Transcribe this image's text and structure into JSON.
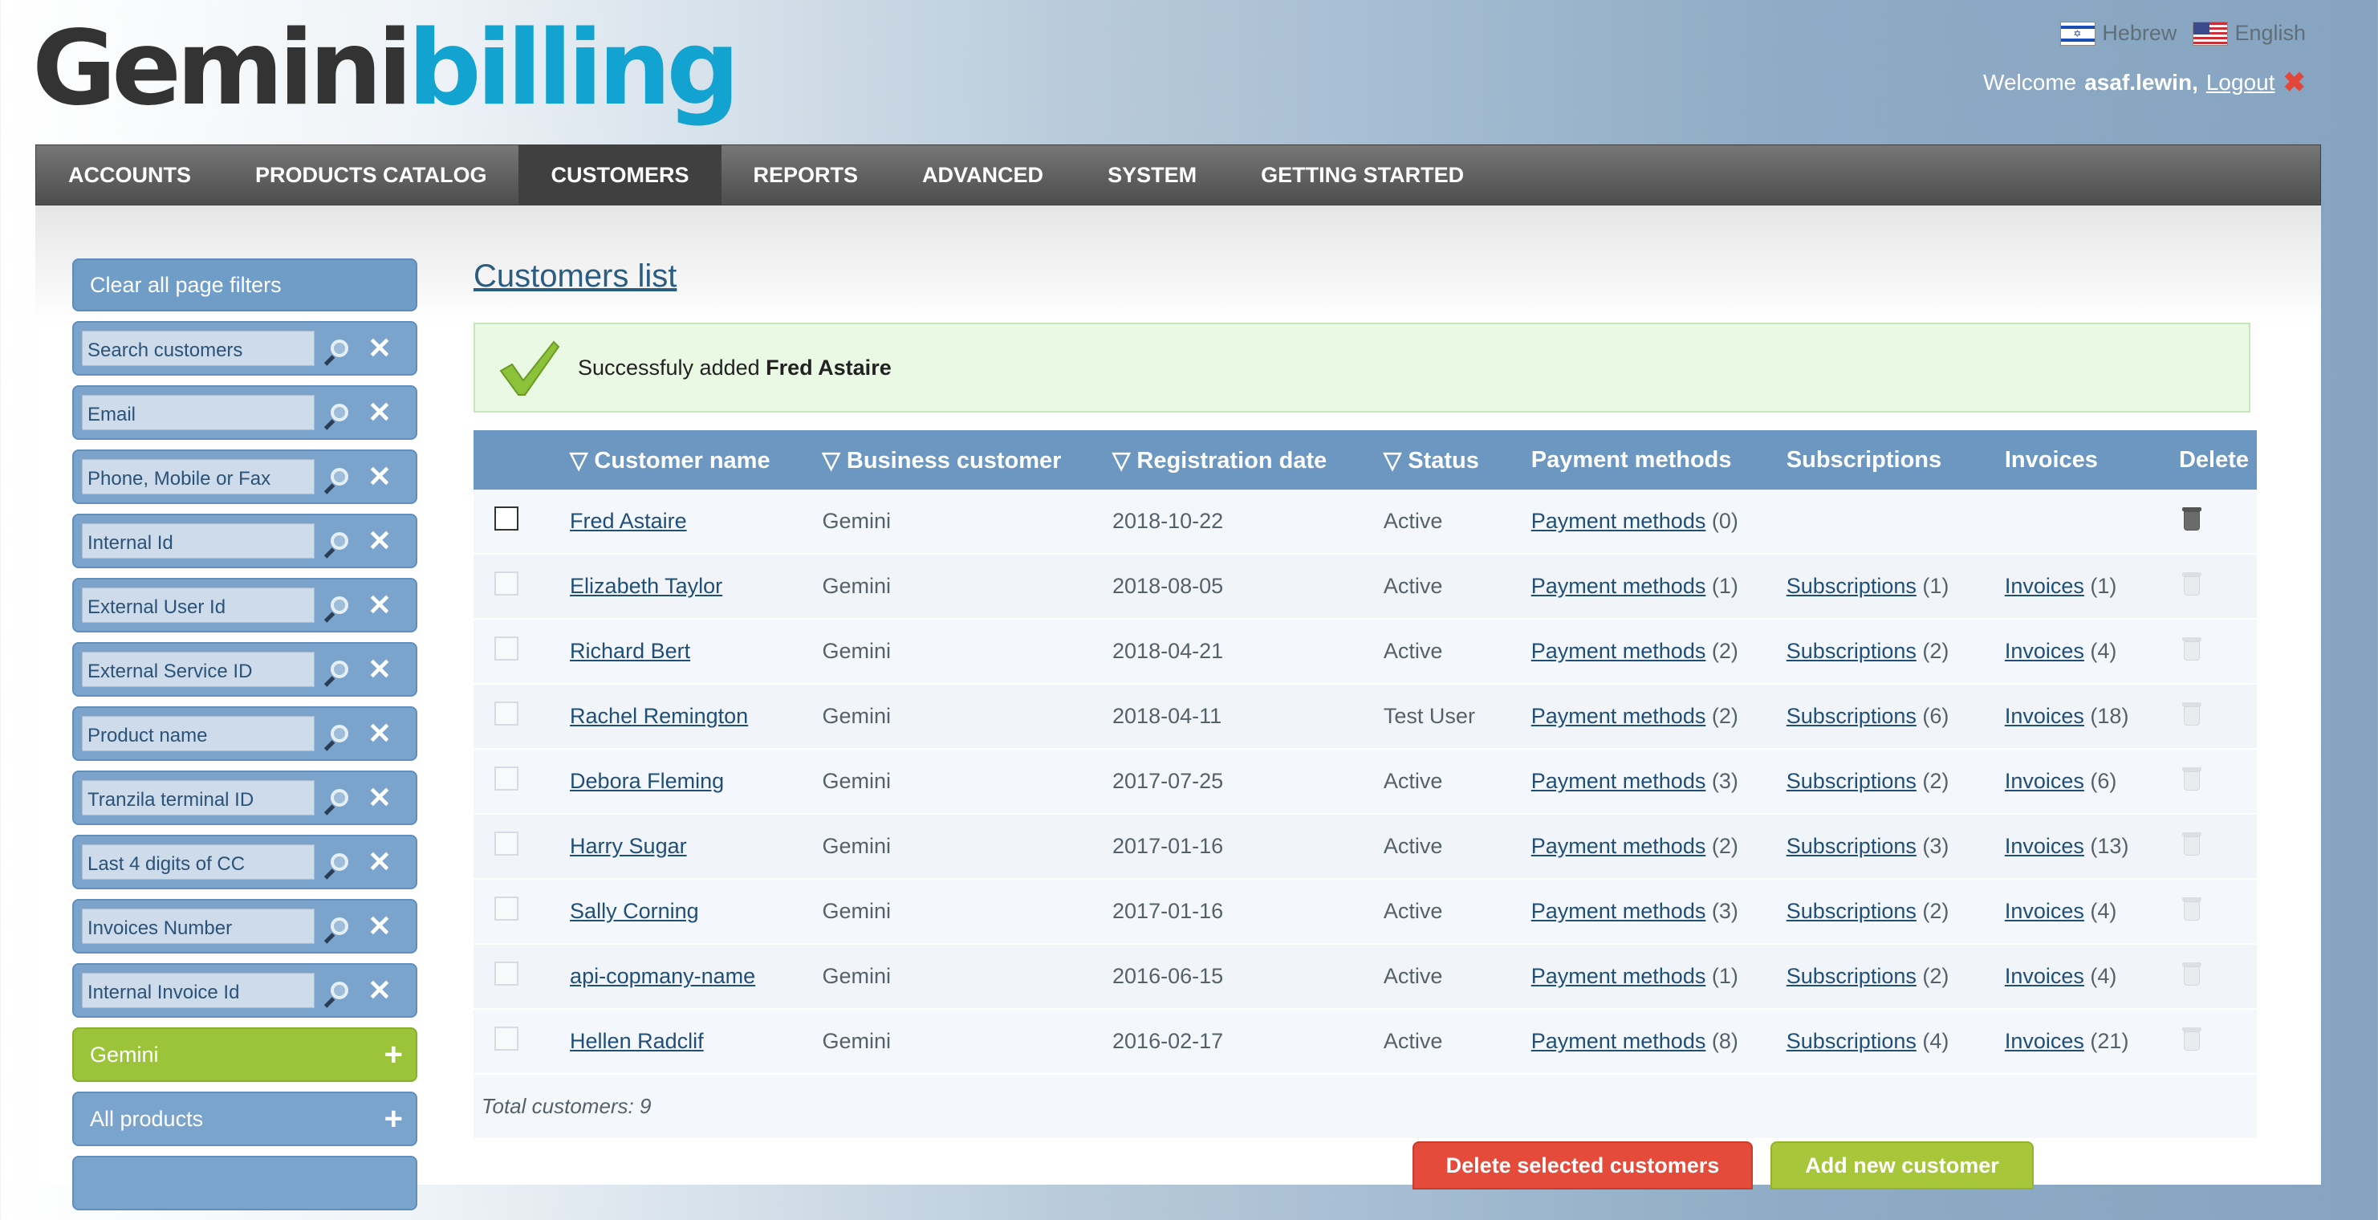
{
  "header": {
    "logo_part1": "Gemini",
    "logo_part2": "billing",
    "languages": [
      {
        "label": "Hebrew",
        "icon": "israel-flag-icon"
      },
      {
        "label": "English",
        "icon": "us-flag-icon"
      }
    ],
    "welcome_text": "Welcome",
    "username": "asaf.lewin,",
    "logout_label": "Logout"
  },
  "nav": {
    "tabs": [
      "ACCOUNTS",
      "PRODUCTS CATALOG",
      "CUSTOMERS",
      "REPORTS",
      "ADVANCED",
      "SYSTEM",
      "GETTING STARTED"
    ],
    "active": "CUSTOMERS"
  },
  "sidebar": {
    "clear_label": "Clear all page filters",
    "filters": [
      "Search customers",
      "Email",
      "Phone, Mobile or Fax",
      "Internal Id",
      "External User Id",
      "External Service ID",
      "Product name",
      "Tranzila terminal ID",
      "Last 4 digits of CC",
      "Invoices Number",
      "Internal Invoice Id"
    ],
    "groups": [
      {
        "label": "Gemini",
        "color": "#9bc43a"
      },
      {
        "label": "All products",
        "color": "#7aa4cc"
      }
    ]
  },
  "main": {
    "title": "Customers list",
    "success": {
      "prefix": "Successfuly added",
      "name": "Fred Astaire"
    },
    "columns": [
      "▽ Customer name",
      "▽ Business customer",
      "▽ Registration date",
      "▽ Status",
      "Payment methods",
      "Subscriptions",
      "Invoices",
      "Delete"
    ],
    "rows": [
      {
        "name": "Fred Astaire",
        "business": "Gemini",
        "date": "2018-10-22",
        "status": "Active",
        "payment": "Payment methods",
        "payment_count": "(0)",
        "subs": "",
        "subs_count": "",
        "inv": "",
        "inv_count": ""
      },
      {
        "name": "Elizabeth Taylor",
        "business": "Gemini",
        "date": "2018-08-05",
        "status": "Active",
        "payment": "Payment methods",
        "payment_count": "(1)",
        "subs": "Subscriptions",
        "subs_count": "(1)",
        "inv": "Invoices",
        "inv_count": "(1)"
      },
      {
        "name": "Richard Bert",
        "business": "Gemini",
        "date": "2018-04-21",
        "status": "Active",
        "payment": "Payment methods",
        "payment_count": "(2)",
        "subs": "Subscriptions",
        "subs_count": "(2)",
        "inv": "Invoices",
        "inv_count": "(4)"
      },
      {
        "name": "Rachel Remington",
        "business": "Gemini",
        "date": "2018-04-11",
        "status": "Test User",
        "payment": "Payment methods",
        "payment_count": "(2)",
        "subs": "Subscriptions",
        "subs_count": "(6)",
        "inv": "Invoices",
        "inv_count": "(18)"
      },
      {
        "name": "Debora Fleming",
        "business": "Gemini",
        "date": "2017-07-25",
        "status": "Active",
        "payment": "Payment methods",
        "payment_count": "(3)",
        "subs": "Subscriptions",
        "subs_count": "(2)",
        "inv": "Invoices",
        "inv_count": "(6)"
      },
      {
        "name": "Harry Sugar",
        "business": "Gemini",
        "date": "2017-01-16",
        "status": "Active",
        "payment": "Payment methods",
        "payment_count": "(2)",
        "subs": "Subscriptions",
        "subs_count": "(3)",
        "inv": "Invoices",
        "inv_count": "(13)"
      },
      {
        "name": "Sally Corning",
        "business": "Gemini",
        "date": "2017-01-16",
        "status": "Active",
        "payment": "Payment methods",
        "payment_count": "(3)",
        "subs": "Subscriptions",
        "subs_count": "(2)",
        "inv": "Invoices",
        "inv_count": "(4)"
      },
      {
        "name": "api-copmany-name",
        "business": "Gemini",
        "date": "2016-06-15",
        "status": "Active",
        "payment": "Payment methods",
        "payment_count": "(1)",
        "subs": "Subscriptions",
        "subs_count": "(2)",
        "inv": "Invoices",
        "inv_count": "(4)"
      },
      {
        "name": "Hellen Radclif",
        "business": "Gemini",
        "date": "2016-02-17",
        "status": "Active",
        "payment": "Payment methods",
        "payment_count": "(8)",
        "subs": "Subscriptions",
        "subs_count": "(4)",
        "inv": "Invoices",
        "inv_count": "(21)"
      }
    ],
    "total_label": "Total customers: 9",
    "delete_selected_label": "Delete selected customers",
    "add_new_label": "Add new customer"
  },
  "colors": {
    "accent_blue": "#6c97c1",
    "brand_cyan": "#12a3d0",
    "green": "#9bc43a",
    "red": "#e44b3a"
  }
}
